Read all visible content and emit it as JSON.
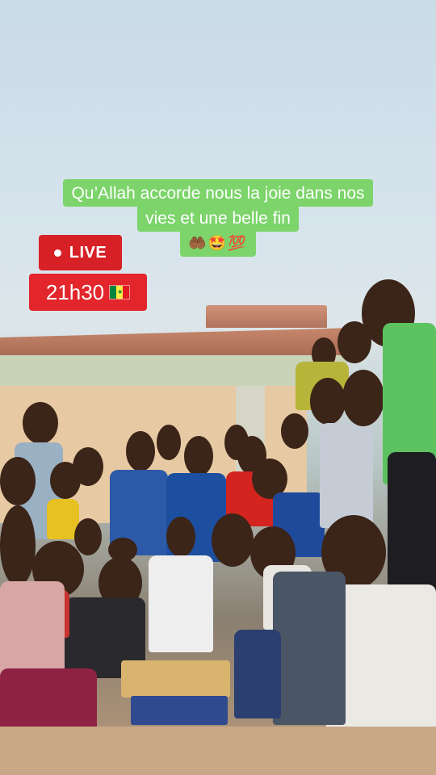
{
  "caption": {
    "line1": "Qu’Allah accorde nous la joie dans nos",
    "line2": "vies et une belle fin",
    "line3_emojis": "🤲🏾🤩💯"
  },
  "live_badge": {
    "label": "LIVE"
  },
  "time_badge": {
    "time": "21h30",
    "flag": "Senegal flag"
  },
  "colors": {
    "caption_bg": "#7cd46a",
    "caption_text": "#ffffff",
    "live_bg": "#d72127",
    "time_bg": "#e2262c"
  }
}
